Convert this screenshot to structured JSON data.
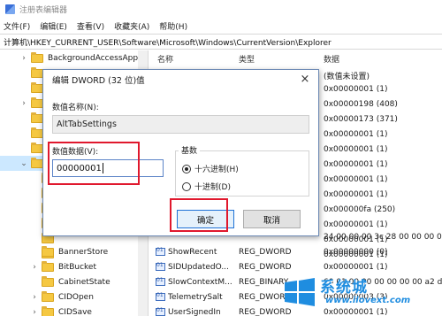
{
  "window": {
    "title": "注册表编辑器"
  },
  "menu": [
    "文件(F)",
    "编辑(E)",
    "查看(V)",
    "收藏夹(A)",
    "帮助(H)"
  ],
  "address": "计算机\\HKEY_CURRENT_USER\\Software\\Microsoft\\Windows\\CurrentVersion\\Explorer",
  "tree": {
    "items": [
      {
        "label": "BackgroundAccessAppli",
        "chev": "›"
      },
      {
        "label": "",
        "chev": ""
      },
      {
        "label": "C",
        "chev": ""
      },
      {
        "label": "C",
        "chev": "›"
      },
      {
        "label": "C",
        "chev": ""
      },
      {
        "label": "C",
        "chev": ""
      },
      {
        "label": "C",
        "chev": ""
      },
      {
        "label": "E",
        "chev": "⌄"
      },
      {
        "label": "",
        "chev": ""
      },
      {
        "label": "",
        "chev": ""
      },
      {
        "label": "",
        "chev": ""
      },
      {
        "label": "",
        "chev": ""
      },
      {
        "label": "",
        "chev": ""
      },
      {
        "label": "",
        "chev": ""
      },
      {
        "label": "BannerStore",
        "chev": ""
      },
      {
        "label": "BitBucket",
        "chev": "›"
      },
      {
        "label": "CabinetState",
        "chev": ""
      },
      {
        "label": "CIDOpen",
        "chev": "›"
      },
      {
        "label": "CIDSave",
        "chev": "›"
      }
    ]
  },
  "list": {
    "headers": {
      "name": "名称",
      "type": "类型",
      "data": "数据"
    },
    "rows": [
      {
        "name": "",
        "type": "",
        "data": "(数值未设置)"
      },
      {
        "name": "",
        "type": "",
        "data": "0x00000001 (1)"
      },
      {
        "name": "",
        "type": "",
        "data": "0x00000198 (408)"
      },
      {
        "name": "",
        "type": "",
        "data": "0x00000173 (371)"
      },
      {
        "name": "",
        "type": "",
        "data": "0x00000001 (1)"
      },
      {
        "name": "",
        "type": "",
        "data": "0x00000001 (1)"
      },
      {
        "name": "",
        "type": "",
        "data": "0x00000001 (1)"
      },
      {
        "name": "",
        "type": "",
        "data": "0x00000001 (1)"
      },
      {
        "name": "",
        "type": "",
        "data": "0x00000001 (1)"
      },
      {
        "name": "",
        "type": "",
        "data": "0x000000fa (250)"
      },
      {
        "name": "",
        "type": "",
        "data": "0x00000001 (1)"
      },
      {
        "name": "",
        "type": "",
        "data": "0x00000001 (1)"
      },
      {
        "name": "",
        "type": "",
        "data": "0x00000001 (1)"
      },
      {
        "name": "",
        "type": "",
        "data": "24 00 00 00 3c 28 00 00 00 00 00"
      },
      {
        "name": "ShowRecent",
        "type": "REG_DWORD",
        "data": "0x00000000 (0)"
      },
      {
        "name": "SIDUpdatedO...",
        "type": "REG_DWORD",
        "data": "0x00000001 (1)"
      },
      {
        "name": "SlowContextM...",
        "type": "REG_BINARY",
        "data": "60 01 00 00 00 00 00 00 a2 d"
      },
      {
        "name": "TelemetrySalt",
        "type": "REG_DWORD",
        "data": "0x00000003 (3)"
      },
      {
        "name": "UserSignedIn",
        "type": "REG_DWORD",
        "data": "0x00000001 (1)"
      }
    ]
  },
  "dialog": {
    "title": "编辑 DWORD (32 位)值",
    "close_icon": "×",
    "name_label": "数值名称(N):",
    "name_value": "AltTabSettings",
    "data_label": "数值数据(V):",
    "data_value": "00000001",
    "base_label": "基数",
    "hex_label": "十六进制(H)",
    "dec_label": "十进制(D)",
    "ok_label": "确定",
    "cancel_label": "取消",
    "selected_base": "hex"
  },
  "watermark": {
    "text": "系统城",
    "url": "www.xitongcheng.com",
    "visible_url": "www.ilovext.com",
    "brand": "ilovext"
  },
  "colors": {
    "highlight": "#e0182d",
    "selection": "#cce8ff",
    "accent": "#1f72d6"
  }
}
